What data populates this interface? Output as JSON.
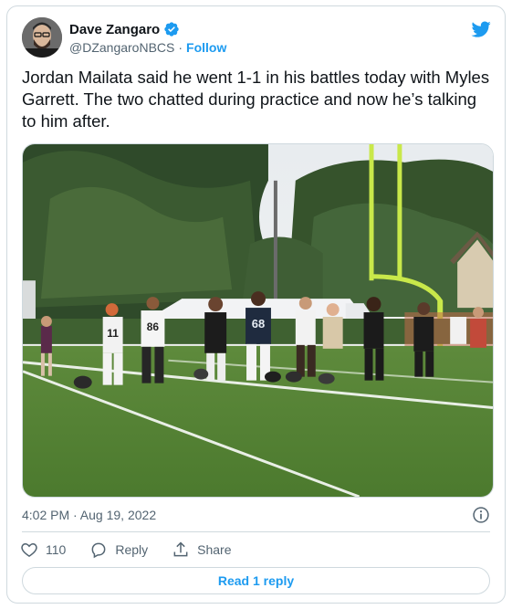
{
  "author": {
    "display_name": "Dave Zangaro",
    "handle": "@DZangaroNBCS",
    "separator": "·",
    "follow_label": "Follow"
  },
  "tweet": {
    "text": "Jordan Mailata said he went 1-1 in his battles today with Myles Garrett. The two chatted during practice and now he’s talking to him after.",
    "time": "4:02 PM · Aug 19, 2022"
  },
  "media": {
    "jersey_numbers": [
      "11",
      "86",
      "68"
    ]
  },
  "actions": {
    "like_count": "110",
    "reply_label": "Reply",
    "share_label": "Share"
  },
  "footer": {
    "read_replies_label": "Read 1 reply"
  },
  "icons": {
    "verified": "verified-badge-icon",
    "brand": "twitter-bird-icon",
    "info": "info-icon",
    "like": "heart-icon",
    "reply": "speech-bubble-icon",
    "share": "share-upload-icon"
  },
  "colors": {
    "accent": "#1d9bf0",
    "text": "#0f1419",
    "secondary": "#536471",
    "border": "#cfd9de"
  }
}
